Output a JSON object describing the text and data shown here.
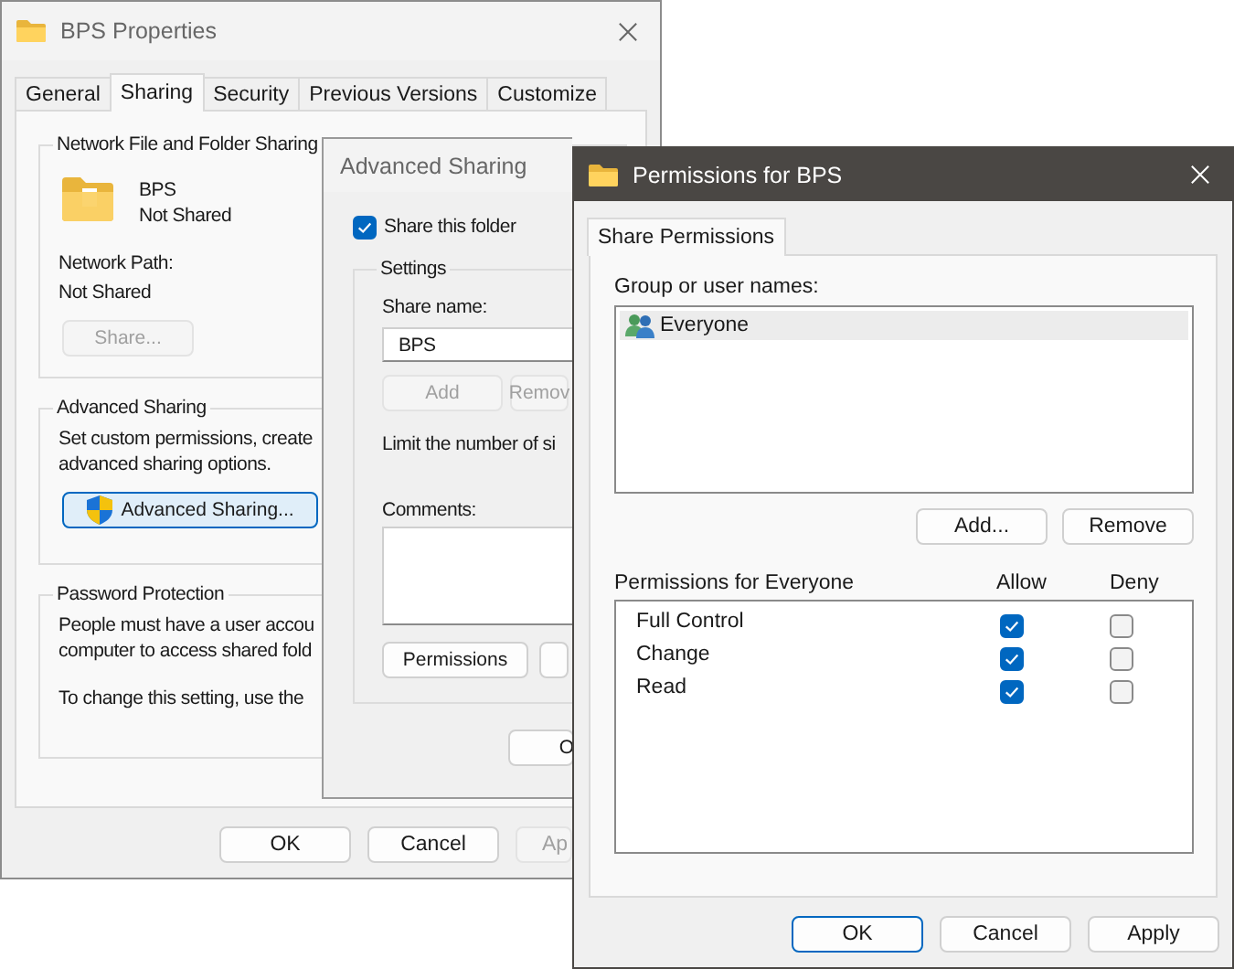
{
  "properties_window": {
    "title": "BPS Properties",
    "tabs": [
      {
        "label": "General",
        "selected": false
      },
      {
        "label": "Sharing",
        "selected": true
      },
      {
        "label": "Security",
        "selected": false
      },
      {
        "label": "Previous Versions",
        "selected": false
      },
      {
        "label": "Customize",
        "selected": false
      }
    ],
    "network_group": {
      "legend": "Network File and Folder Sharing",
      "folder_name": "BPS",
      "folder_status": "Not Shared",
      "path_label": "Network Path:",
      "path_value": "Not Shared",
      "share_button": {
        "label": "Share...",
        "disabled": true,
        "default": false
      }
    },
    "advanced_group": {
      "legend": "Advanced Sharing",
      "lines": [
        "Set custom permissions, create",
        "advanced sharing options."
      ],
      "button": {
        "label": "Advanced Sharing...",
        "disabled": false,
        "default": true
      }
    },
    "password_group": {
      "legend": "Password Protection",
      "lines": [
        "People must have a user accou",
        "computer to access shared fold"
      ],
      "note": "To change this setting, use the"
    },
    "buttons": [
      {
        "label": "OK",
        "disabled": false,
        "default": false
      },
      {
        "label": "Cancel",
        "disabled": false,
        "default": false
      },
      {
        "label": "Ap",
        "disabled": true,
        "default": false
      }
    ]
  },
  "advanced_sharing_window": {
    "title": "Advanced Sharing",
    "share_checkbox": {
      "label": "Share this folder",
      "checked": true
    },
    "settings": {
      "legend": "Settings",
      "share_name_label": "Share name:",
      "share_name_value": "BPS",
      "buttons": [
        {
          "label": "Add",
          "disabled": true,
          "default": false
        },
        {
          "label": "Remov",
          "disabled": true,
          "default": false
        }
      ],
      "limit_text": "Limit the number of si",
      "comments_label": "Comments:",
      "lower_buttons": [
        {
          "label": "Permissions",
          "disabled": false,
          "default": false
        }
      ]
    },
    "ok_button": {
      "label": "O",
      "disabled": false,
      "default": false
    }
  },
  "permissions_window": {
    "title": "Permissions for BPS",
    "tabs": [
      {
        "label": "Share Permissions",
        "selected": true
      }
    ],
    "names_label": "Group or user names:",
    "names": [
      {
        "name": "Everyone",
        "selected": true
      }
    ],
    "name_buttons": [
      {
        "label": "Add...",
        "disabled": false,
        "default": false
      },
      {
        "label": "Remove",
        "disabled": false,
        "default": false
      }
    ],
    "permissions_header": {
      "label": "Permissions for Everyone",
      "allow": "Allow",
      "deny": "Deny"
    },
    "permissions": [
      {
        "name": "Full Control",
        "allow": true,
        "deny": false
      },
      {
        "name": "Change",
        "allow": true,
        "deny": false
      },
      {
        "name": "Read",
        "allow": true,
        "deny": false
      }
    ],
    "buttons": [
      {
        "label": "OK",
        "disabled": false,
        "default": true
      },
      {
        "label": "Cancel",
        "disabled": false,
        "default": false
      },
      {
        "label": "Apply",
        "disabled": false,
        "default": false
      }
    ]
  }
}
